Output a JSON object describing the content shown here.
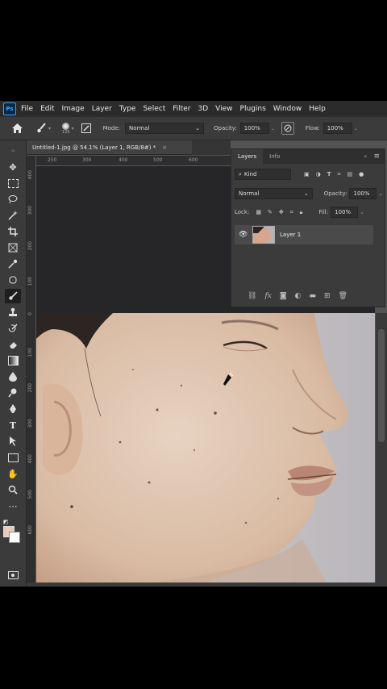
{
  "menu": [
    "File",
    "Edit",
    "Image",
    "Layer",
    "Type",
    "Select",
    "Filter",
    "3D",
    "View",
    "Plugins",
    "Window",
    "Help"
  ],
  "app_logo": "Ps",
  "options": {
    "brush_size": "125",
    "mode_label": "Mode:",
    "mode_value": "Normal",
    "opacity_label": "Opacity:",
    "opacity_value": "100%",
    "flow_label": "Flow:",
    "flow_value": "100%"
  },
  "document": {
    "tab_title": "Untitled-1.jpg @ 54.1% (Layer 1, RGB/8#) *",
    "close": "×"
  },
  "ruler": {
    "h_ticks": [
      "250",
      "300",
      "400",
      "500",
      "600"
    ],
    "v_ticks": [
      "400",
      "300",
      "200",
      "100",
      "0",
      "100",
      "200",
      "300",
      "400",
      "500",
      "600"
    ]
  },
  "layers_panel": {
    "tabs": [
      "Layers",
      "Info"
    ],
    "kind_label": "Kind",
    "blend_mode": "Normal",
    "opacity_label": "Opacity:",
    "opacity_value": "100%",
    "lock_label": "Lock:",
    "fill_label": "Fill:",
    "fill_value": "100%",
    "layer_name": "Layer 1"
  },
  "colors": {
    "foreground": "#e8c9bb",
    "background": "#ffffff",
    "accent": "#31a8ff"
  }
}
